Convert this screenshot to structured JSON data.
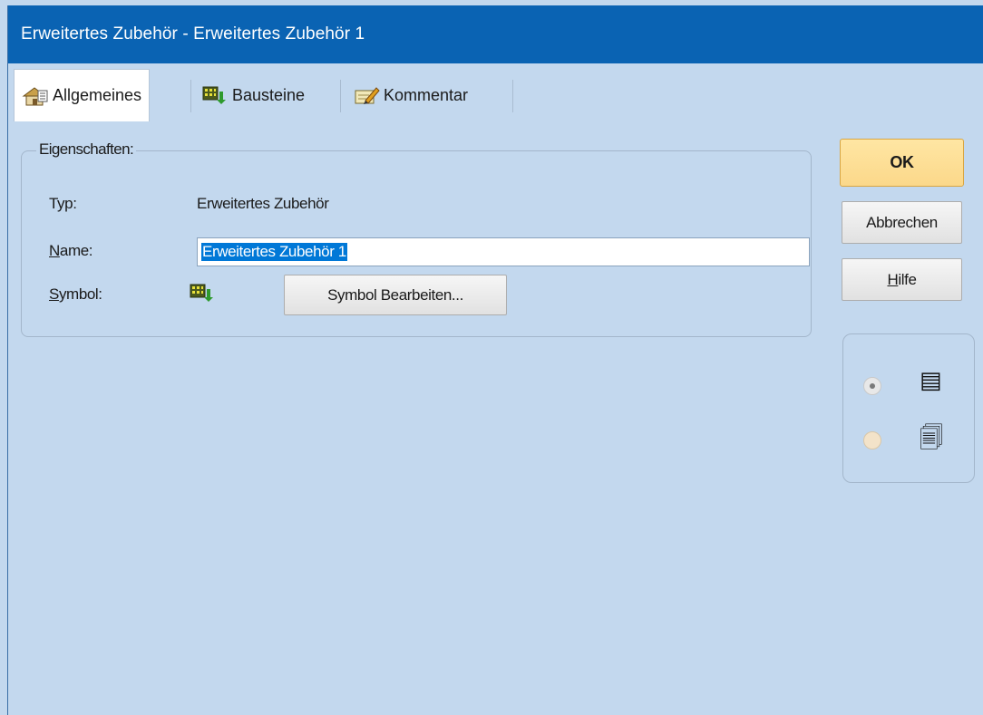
{
  "window": {
    "title": "Erweitertes Zubehör - Erweitertes Zubehör 1"
  },
  "tabs": [
    {
      "label": "Allgemeines",
      "icon": "house-properties-icon",
      "active": true
    },
    {
      "label": "Bausteine",
      "icon": "blocks-icon",
      "active": false
    },
    {
      "label": "Kommentar",
      "icon": "comment-edit-icon",
      "active": false
    }
  ],
  "properties": {
    "group_label": "Eigenschaften:",
    "type_label": "Typ:",
    "type_value": "Erweitertes Zubehör",
    "name_label_accel": "N",
    "name_label_rest": "ame:",
    "name_value": "Erweitertes Zubehör 1",
    "symbol_label_accel": "S",
    "symbol_label_rest": "ymbol:",
    "symbol_icon": "blocks-icon",
    "edit_symbol_button": "Symbol Bearbeiten..."
  },
  "buttons": {
    "ok": "OK",
    "cancel": "Abbrechen",
    "help_accel": "H",
    "help_rest": "ilfe"
  },
  "view_options": [
    {
      "icon": "list-view-icon",
      "glyph": "▤",
      "selected": true
    },
    {
      "icon": "multi-window-icon",
      "glyph": "🗐",
      "selected": false
    }
  ],
  "colors": {
    "titlebar": "#0a63b3",
    "background": "#c3d8ee",
    "selection": "#0078d7",
    "ok_button": "#fbd88a"
  }
}
